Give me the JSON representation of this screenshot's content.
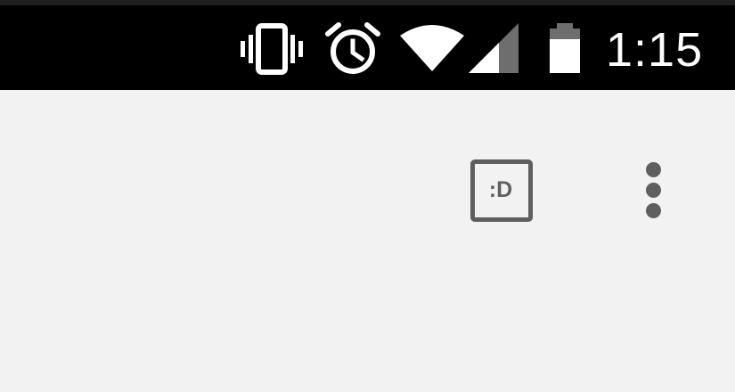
{
  "status_bar": {
    "time": "1:15",
    "icons": [
      "vibrate-icon",
      "alarm-icon",
      "wifi-icon",
      "cell-signal-icon",
      "battery-icon"
    ],
    "background": "#000000",
    "foreground": "#ffffff"
  },
  "toolbar": {
    "emoji_button_label": ":D",
    "emoji_button_icon": "emoji-keyboard-icon",
    "more_icon": "more-vert-icon",
    "icon_color": "#5f5f5f"
  },
  "content": {
    "background": "#f2f2f2"
  }
}
